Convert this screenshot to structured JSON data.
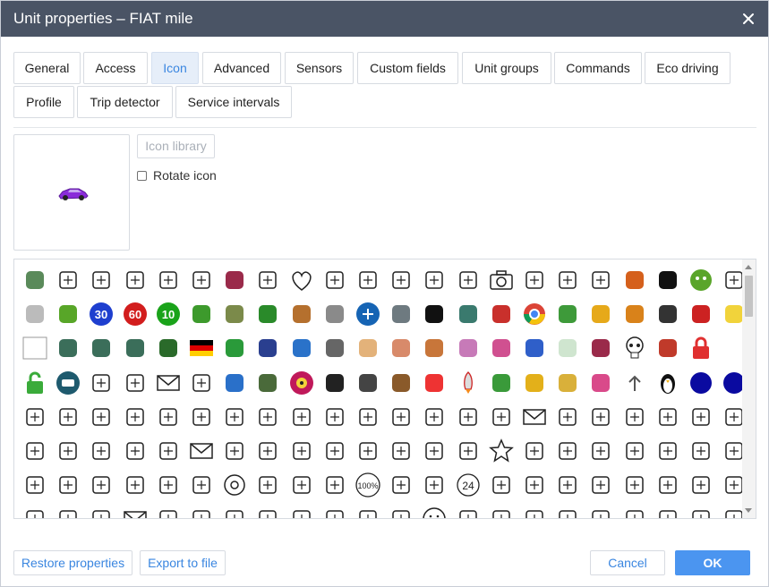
{
  "window": {
    "title": "Unit properties – FIAT mile"
  },
  "tabs": [
    {
      "label": "General",
      "active": false
    },
    {
      "label": "Access",
      "active": false
    },
    {
      "label": "Icon",
      "active": true
    },
    {
      "label": "Advanced",
      "active": false
    },
    {
      "label": "Sensors",
      "active": false
    },
    {
      "label": "Custom fields",
      "active": false
    },
    {
      "label": "Unit groups",
      "active": false
    },
    {
      "label": "Commands",
      "active": false
    },
    {
      "label": "Eco driving",
      "active": false
    },
    {
      "label": "Profile",
      "active": false
    },
    {
      "label": "Trip detector",
      "active": false
    },
    {
      "label": "Service intervals",
      "active": false
    }
  ],
  "icon_panel": {
    "library_button": "Icon library",
    "rotate_label": "Rotate icon",
    "rotate_checked": false,
    "current_icon": "purple-car-icon"
  },
  "icon_grid": {
    "rows": [
      [
        "road-sign-icon",
        "arch-icon",
        "bride-icon",
        "wedding-cake-icon",
        "calendar-heart-icon",
        "bride-dress-icon",
        "flowers-icon",
        "champagne-icon",
        "heart-icon",
        "love-letter-icon",
        "heart-pin-icon",
        "microphone-icon",
        "music-note-icon",
        "notebook-icon",
        "camera-icon",
        "doctor-icon",
        "ring-icon",
        "film-camera-icon",
        "robot-icon",
        "shuttle-icon",
        "green-monster-icon",
        "garage-icon"
      ],
      [
        "rabbit-icon",
        "green-truck-icon",
        "speed-30-icon",
        "speed-60-icon",
        "speed-10-icon",
        "pepe-frog-icon",
        "tank-truck-icon",
        "tractor-icon",
        "cow-icon",
        "cat-icon",
        "satellite-icon",
        "seal-icon",
        "black-car-icon",
        "sports-car-icon",
        "fire-truck-icon",
        "chrome-icon",
        "octopus-icon",
        "school-bus-icon",
        "dump-truck-icon",
        "top-hat-man-icon",
        "red-car-icon",
        "minion-icon"
      ],
      [
        "broken-image-icon",
        "tank-icon",
        "tank-icon",
        "tank-icon",
        "sign-icon",
        "germany-flag-icon",
        "ambulance-icon",
        "usa-eagle-icon",
        "transfer-icon",
        "database-icon",
        "footprints-icon",
        "woman-avatar-icon",
        "boy-icon",
        "coffee-cup-icon",
        "stroller-icon",
        "blue-car-icon",
        "map-icon",
        "flowers-icon",
        "skull-icon",
        "spider-icon",
        "padlock-icon",
        ""
      ],
      [
        "unlock-icon",
        "van-icon",
        "sparkles-icon",
        "user-icon",
        "mail-icon",
        "film-camera-icon",
        "wifi-icon",
        "camouflage-icon",
        "radiation-icon",
        "nun-icon",
        "delivery-icon",
        "deer-icon",
        "first-aid-icon",
        "rocket-icon",
        "sprout-icon",
        "excavator-icon",
        "hedgehog-icon",
        "girl-icon",
        "arrow-up-icon",
        "penguin-icon",
        "blue-dot-icon",
        "blue-dot-icon"
      ],
      [
        "santa-icon",
        "flask-icon",
        "books-icon",
        "brain-icon",
        "calendar-icon",
        "trophy-icon",
        "percent-icon",
        "easel-icon",
        "glasses-icon",
        "team-icon",
        "graduation-icon",
        "hourglass-icon",
        "lightbulb-icon",
        "clipboard-icon",
        "location-pin-icon",
        "mail-icon",
        "phone-icon",
        "wallet-icon",
        "receptionist-icon",
        "student-icon",
        "stopwatch-icon",
        "chat-icon"
      ],
      [
        "calendar-icon",
        "armchair-icon",
        "globe-icon",
        "support-icon",
        "graduation-icon",
        "mail-icon",
        "magnifier-icon",
        "phone-call-icon",
        "notebook-icon",
        "clock-doc-icon",
        "wallet-icon",
        "hourglass-icon",
        "speedometer-icon",
        "presenter-icon",
        "star-icon",
        "hierarchy-icon",
        "target-icon",
        "video-icon",
        "webcam-icon",
        "shopping-bag-icon",
        "package-icon",
        "credit-card-icon"
      ],
      [
        "cart-icon",
        "calculator-icon",
        "discount-icon",
        "tag-percent-icon",
        "hands-icon",
        "worker-icon",
        "at-sign-icon",
        "person-icon",
        "map-location-icon",
        "money-icon",
        "percent-100-icon",
        "smartphone-icon",
        "recycle-icon",
        "hours-24-icon",
        "shop-icon",
        "truck-icon",
        "user-edit-icon",
        "balloons-icon",
        "cake-icon",
        "calendar-icon",
        "cocktail-icon",
        "couple-icon"
      ],
      [
        "disco-ball-icon",
        "mortar-icon",
        "document-icon",
        "mail-icon",
        "location-icon",
        "sparkles-icon",
        "bottle-icon",
        "microphone-icon",
        "music-icon",
        "cupid-icon",
        "gift-icon",
        "phone-icon",
        "smiley-icon",
        "sun-icon",
        "projector-icon",
        "speech-icon",
        "hand-icon",
        "candle-icon",
        "tent-icon",
        "lipstick-icon",
        "pot-icon",
        "settings-icon"
      ]
    ]
  },
  "footer": {
    "restore": "Restore properties",
    "export": "Export to file",
    "cancel": "Cancel",
    "ok": "OK"
  },
  "colors": {
    "titlebar": "#4a5465",
    "accent": "#3a86e0",
    "ok": "#4b95f0"
  }
}
